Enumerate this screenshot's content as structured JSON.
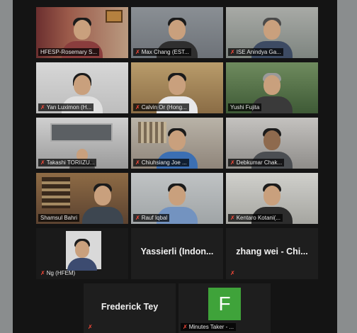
{
  "participants": [
    {
      "name": "HFESP-Rosemary S...",
      "muted": false,
      "active": true
    },
    {
      "name": "Max Chang (EST...",
      "muted": true
    },
    {
      "name": "ISE Anindya Ga...",
      "muted": true
    },
    {
      "name": "Yan Luximon (H...",
      "muted": true
    },
    {
      "name": "Calvin Or (Hong...",
      "muted": true
    },
    {
      "name": "Yushi Fujita",
      "muted": false
    },
    {
      "name": "Takashi TORIIZU...",
      "muted": true
    },
    {
      "name": "Chiuhsiang Joe ...",
      "muted": true
    },
    {
      "name": "Debkumar Chak...",
      "muted": true
    },
    {
      "name": "Shamsul Bahri",
      "muted": false
    },
    {
      "name": "Rauf Iqbal",
      "muted": true
    },
    {
      "name": "Kentaro Kotani(...",
      "muted": true
    },
    {
      "name": "Ng (HFEM)",
      "muted": true
    },
    {
      "name": "Yassierli (Indon...",
      "muted": false,
      "video_off": true
    },
    {
      "name": "zhang wei - Chi...",
      "muted": true,
      "video_off": true
    },
    {
      "name": "Frederick Tey",
      "muted": true,
      "video_off": true
    },
    {
      "name": "Minutes Taker - ...",
      "muted": true,
      "avatar_letter": "F",
      "avatar_color": "#3fa33a"
    }
  ],
  "colors": {
    "active_border": "#c7d44a",
    "mute": "#ff4b3a"
  }
}
